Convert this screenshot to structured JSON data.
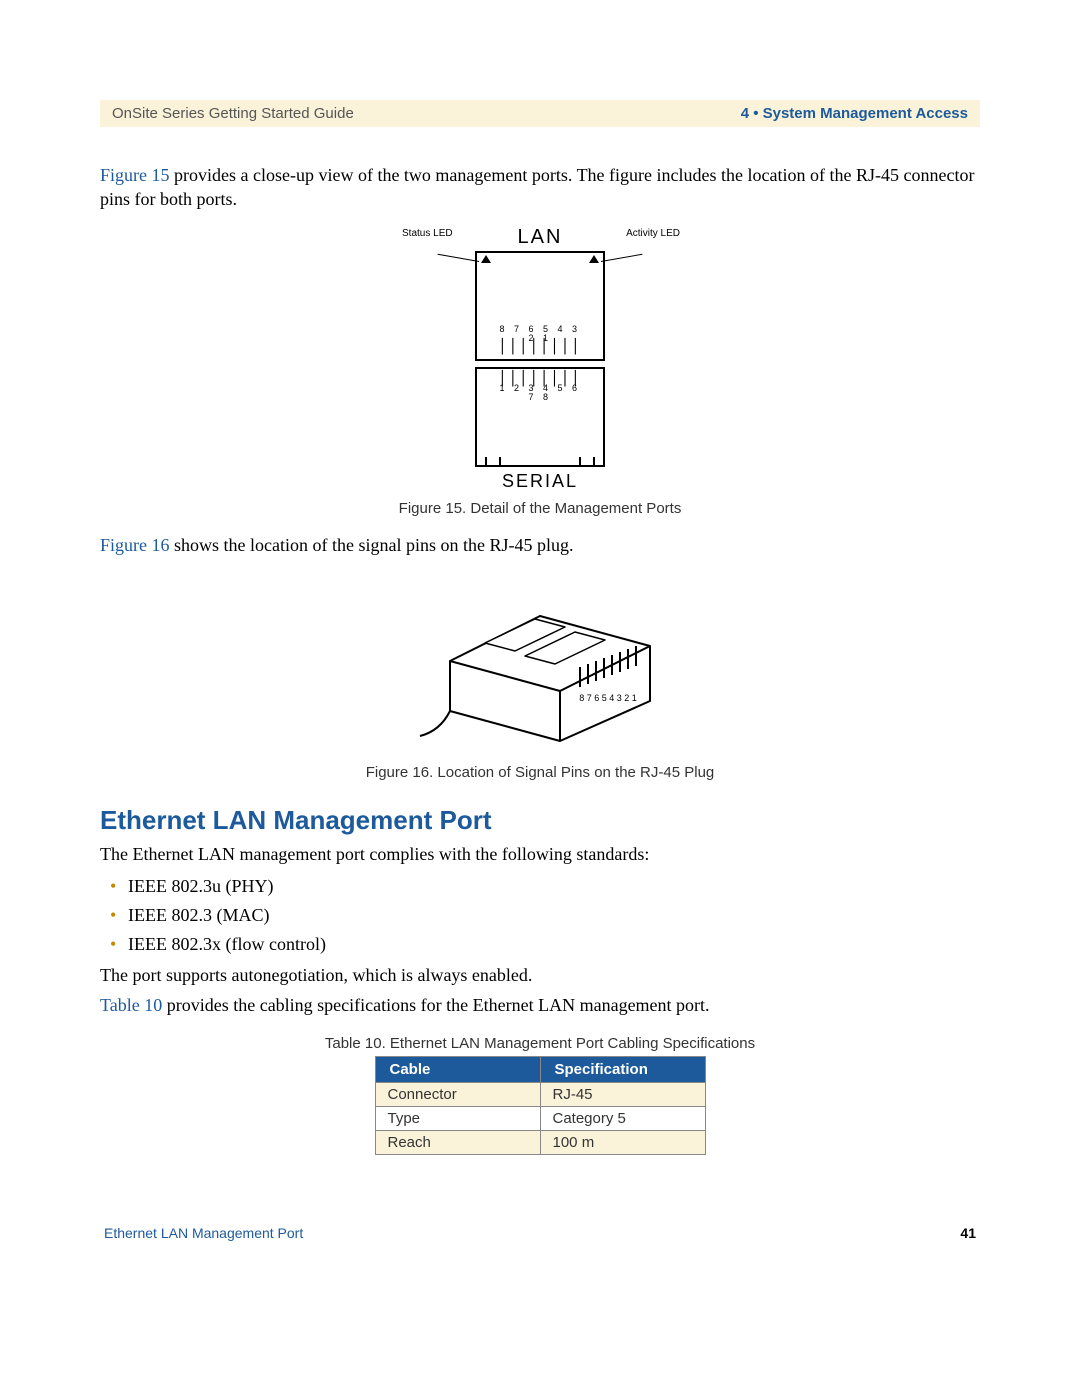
{
  "header": {
    "left": "OnSite Series Getting Started Guide",
    "right": "4 • System Management Access"
  },
  "paragraphs": {
    "p1a": "Figure 15",
    "p1b": " provides a close-up view of the two management ports. The figure includes the location of the RJ-45 connector pins for both ports.",
    "p2a": "Figure 16",
    "p2b": " shows the location of the signal pins on the RJ-45 plug.",
    "p3": "The Ethernet LAN management port complies with the following standards:",
    "p4": "The port supports autonegotiation, which is always enabled.",
    "p5a": "Table 10",
    "p5b": " provides the cabling specifications for the Ethernet LAN management port."
  },
  "figure15": {
    "caption": "Figure 15. Detail of the Management Ports",
    "top_label": "LAN",
    "bottom_label": "SERIAL",
    "status_led": "Status LED",
    "activity_led": "Activity LED",
    "pins_desc": "8 7 6 5 4 3 2 1",
    "pins_asc": "1 2 3 4 5 6 7 8"
  },
  "figure16": {
    "caption": "Figure 16. Location of Signal Pins on the RJ-45 Plug",
    "pins": "8 7 6 5 4 3 2 1"
  },
  "section_heading": "Ethernet LAN Management Port",
  "standards": {
    "s1": "IEEE 802.3u (PHY)",
    "s2": "IEEE 802.3 (MAC)",
    "s3": "IEEE 802.3x (flow control)"
  },
  "table10": {
    "caption": "Table 10. Ethernet LAN Management Port Cabling Specifications",
    "headers": {
      "c1": "Cable",
      "c2": "Specification"
    },
    "rows": {
      "r1": {
        "c1": "Connector",
        "c2": "RJ-45"
      },
      "r2": {
        "c1": "Type",
        "c2": "Category 5"
      },
      "r3": {
        "c1": "Reach",
        "c2": "100 m"
      }
    }
  },
  "footer": {
    "left": "Ethernet LAN Management Port",
    "right": "41"
  }
}
